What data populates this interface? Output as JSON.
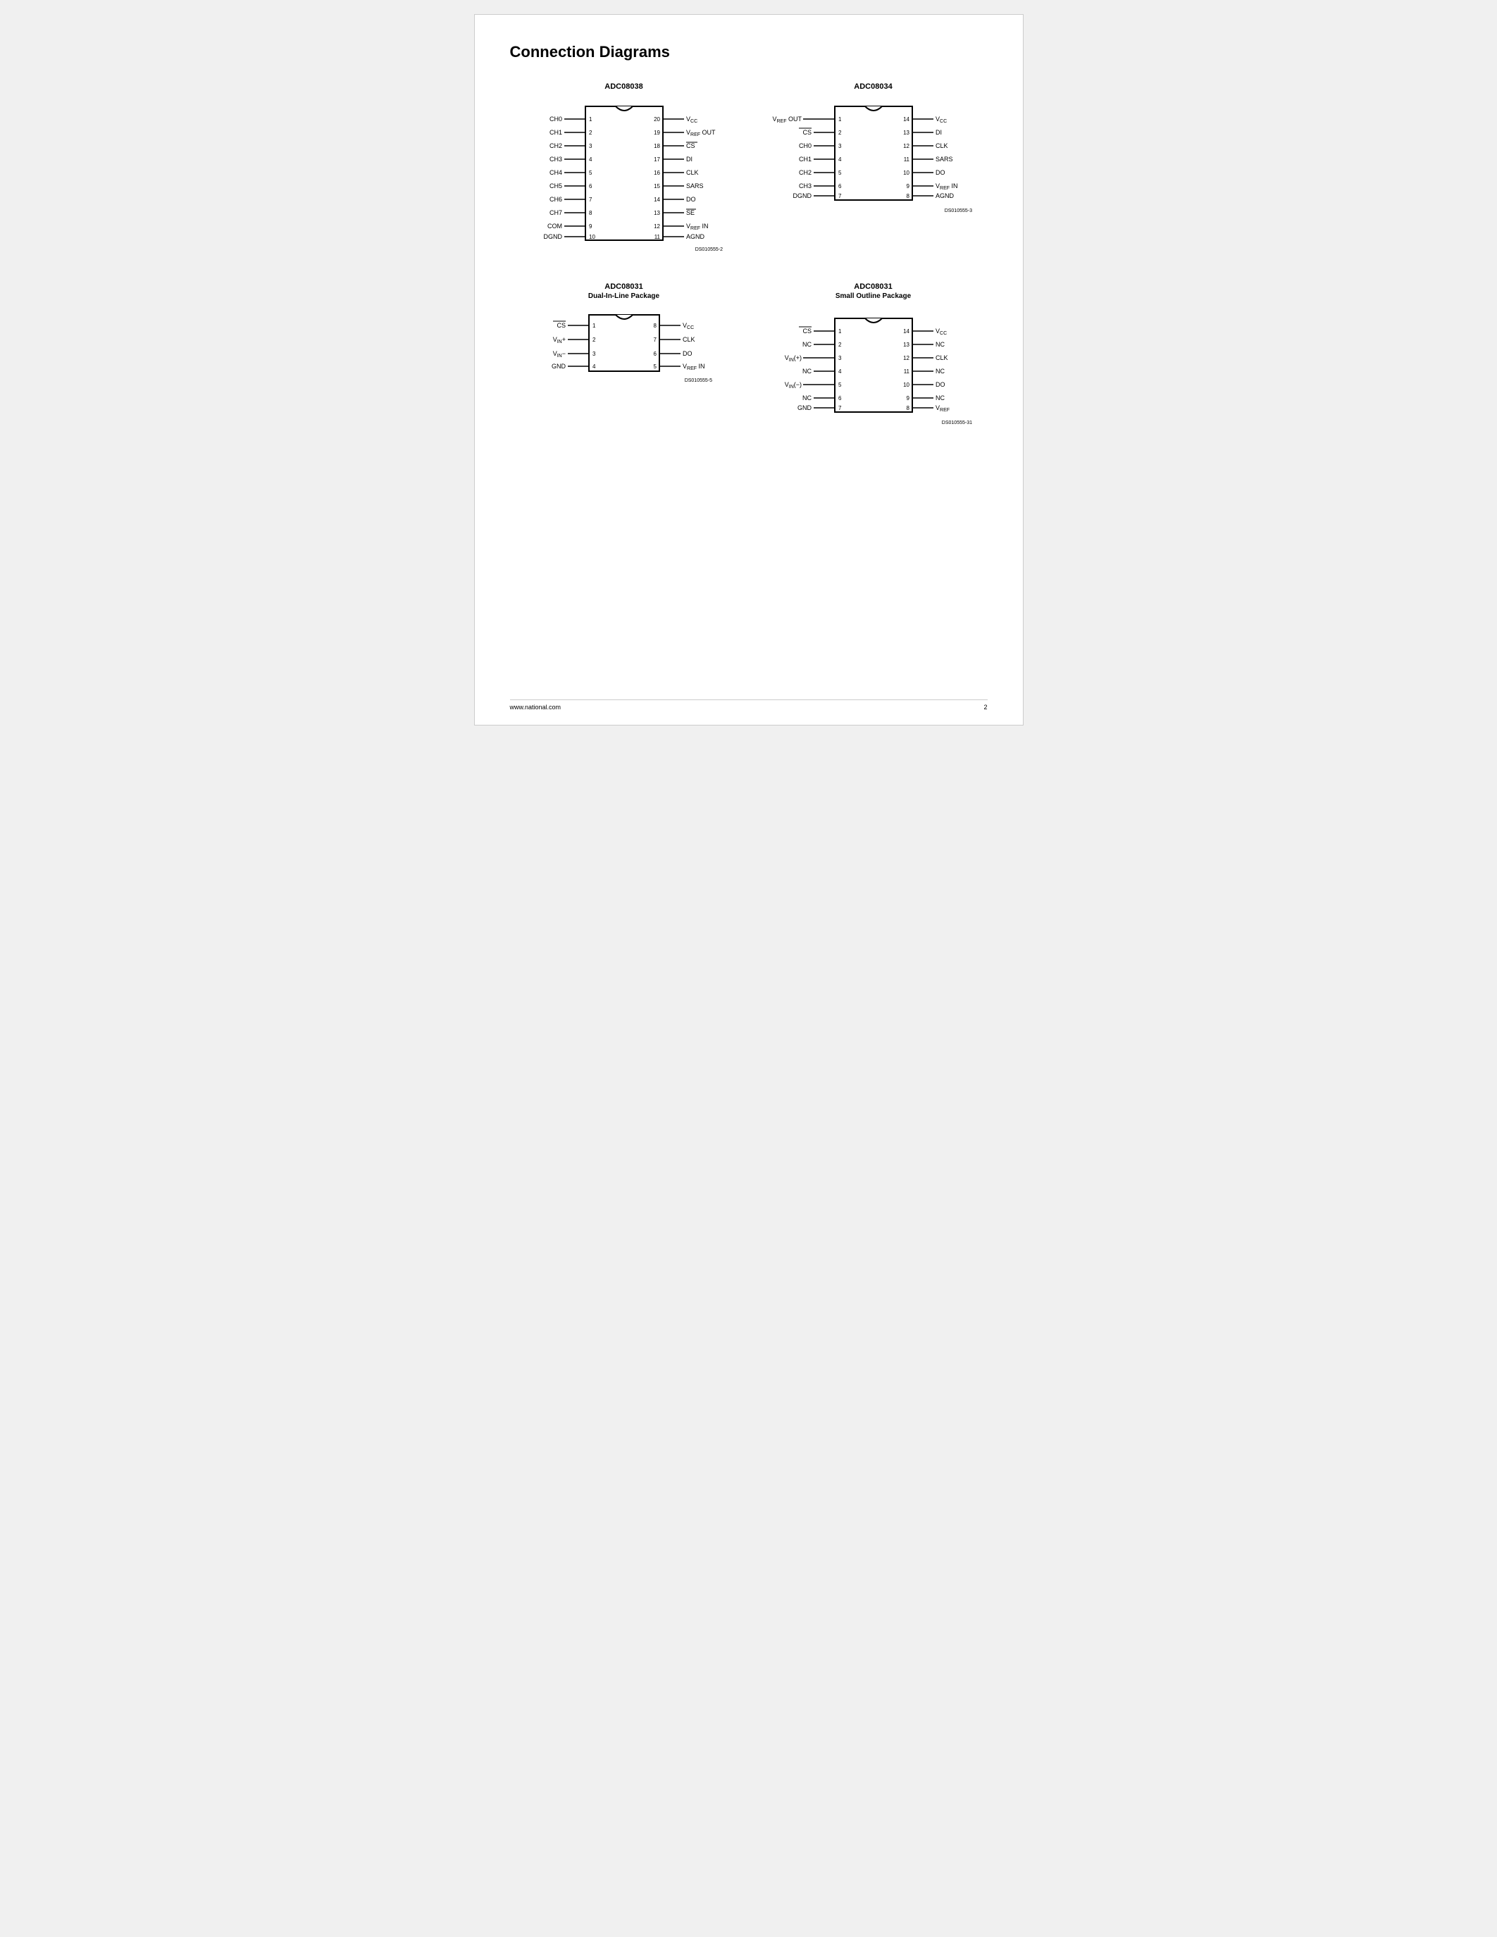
{
  "page": {
    "title": "Connection Diagrams",
    "footer": {
      "url": "www.national.com",
      "page_num": "2"
    }
  },
  "diagrams": {
    "adc08038": {
      "title": "ADC08038",
      "code": "DS010555-2",
      "left_pins": [
        {
          "num": 1,
          "label": "CH0"
        },
        {
          "num": 2,
          "label": "CH1"
        },
        {
          "num": 3,
          "label": "CH2"
        },
        {
          "num": 4,
          "label": "CH3"
        },
        {
          "num": 5,
          "label": "CH4"
        },
        {
          "num": 6,
          "label": "CH5"
        },
        {
          "num": 7,
          "label": "CH6"
        },
        {
          "num": 8,
          "label": "CH7"
        },
        {
          "num": 9,
          "label": "COM"
        },
        {
          "num": 10,
          "label": "DGND"
        }
      ],
      "right_pins": [
        {
          "num": 20,
          "label": "VCC"
        },
        {
          "num": 19,
          "label": "VREF OUT"
        },
        {
          "num": 18,
          "label": "CS_bar"
        },
        {
          "num": 17,
          "label": "DI"
        },
        {
          "num": 16,
          "label": "CLK"
        },
        {
          "num": 15,
          "label": "SARS"
        },
        {
          "num": 14,
          "label": "DO"
        },
        {
          "num": 13,
          "label": "SE_bar"
        },
        {
          "num": 12,
          "label": "VREF IN"
        },
        {
          "num": 11,
          "label": "AGND"
        }
      ]
    },
    "adc08034": {
      "title": "ADC08034",
      "code": "DS010555-3",
      "left_pins": [
        {
          "num": 1,
          "label": "VREF OUT"
        },
        {
          "num": 2,
          "label": "CS_bar"
        },
        {
          "num": 3,
          "label": "CH0"
        },
        {
          "num": 4,
          "label": "CH1"
        },
        {
          "num": 5,
          "label": "CH2"
        },
        {
          "num": 6,
          "label": "CH3"
        },
        {
          "num": 7,
          "label": "DGND"
        }
      ],
      "right_pins": [
        {
          "num": 14,
          "label": "VCC"
        },
        {
          "num": 13,
          "label": "DI"
        },
        {
          "num": 12,
          "label": "CLK"
        },
        {
          "num": 11,
          "label": "SARS"
        },
        {
          "num": 10,
          "label": "DO"
        },
        {
          "num": 9,
          "label": "VREF IN"
        },
        {
          "num": 8,
          "label": "AGND"
        }
      ]
    },
    "adc08031_dil": {
      "title": "ADC08031",
      "subtitle": "Dual-In-Line Package",
      "code": "DS010555-5",
      "left_pins": [
        {
          "num": 1,
          "label": "CS_bar"
        },
        {
          "num": 2,
          "label": "VIN+"
        },
        {
          "num": 3,
          "label": "VIN-"
        },
        {
          "num": 4,
          "label": "GND"
        }
      ],
      "right_pins": [
        {
          "num": 8,
          "label": "VCC"
        },
        {
          "num": 7,
          "label": "CLK"
        },
        {
          "num": 6,
          "label": "DO"
        },
        {
          "num": 5,
          "label": "VREF IN"
        }
      ]
    },
    "adc08031_sop": {
      "title": "ADC08031",
      "subtitle": "Small Outline Package",
      "code": "DS010555-31",
      "left_pins": [
        {
          "num": 1,
          "label": "CS_bar"
        },
        {
          "num": 2,
          "label": "NC"
        },
        {
          "num": 3,
          "label": "VIN(+)"
        },
        {
          "num": 4,
          "label": "NC"
        },
        {
          "num": 5,
          "label": "VIN(-)"
        },
        {
          "num": 6,
          "label": "NC"
        },
        {
          "num": 7,
          "label": "GND"
        }
      ],
      "right_pins": [
        {
          "num": 14,
          "label": "VCC"
        },
        {
          "num": 13,
          "label": "NC"
        },
        {
          "num": 12,
          "label": "CLK"
        },
        {
          "num": 11,
          "label": "NC"
        },
        {
          "num": 10,
          "label": "DO"
        },
        {
          "num": 9,
          "label": "NC"
        },
        {
          "num": 8,
          "label": "VREF"
        }
      ]
    }
  }
}
